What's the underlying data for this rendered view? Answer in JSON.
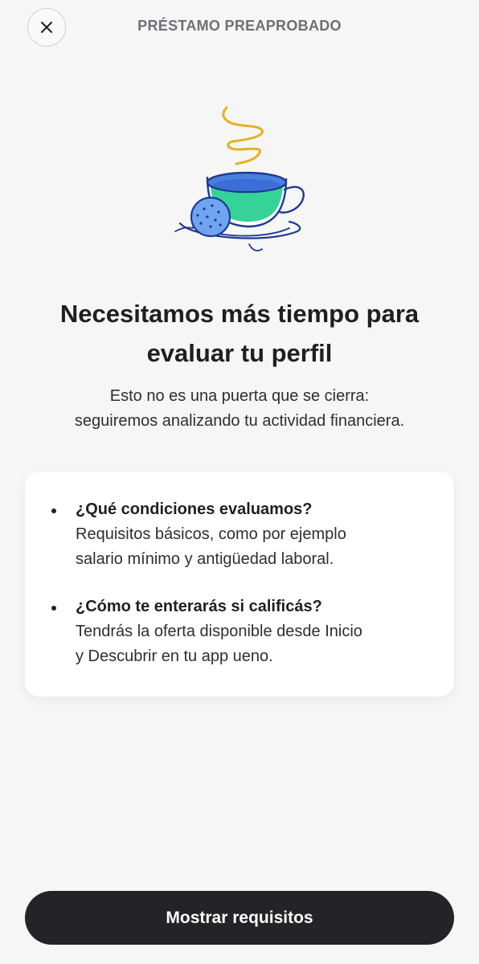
{
  "header": {
    "title": "PRÉSTAMO PREAPROBADO",
    "close_icon": "close-icon"
  },
  "illustration": {
    "name": "tea-cup-with-cookie-illustration",
    "colors": {
      "outline": "#1f3a8f",
      "tea": "#36d399",
      "cup_rim": "#4a7fe0",
      "steam": "#e2b325",
      "cookie": "#6ea4f0"
    }
  },
  "main": {
    "title_line1": "Necesitamos más tiempo para",
    "title_line2": "evaluar tu perfil",
    "subtitle_line1": "Esto no es una puerta que se cierra:",
    "subtitle_line2": "seguiremos analizando tu actividad financiera."
  },
  "info_card": {
    "items": [
      {
        "heading": "¿Qué condiciones evaluamos?",
        "body_line1": "Requisitos básicos, como por ejemplo",
        "body_line2": "salario mínimo y antigüedad laboral."
      },
      {
        "heading": "¿Cómo te enterarás si calificás?",
        "body_line1": "Tendrás la oferta disponible desde Inicio",
        "body_line2": "y Descubrir en tu app ueno."
      }
    ]
  },
  "footer": {
    "button_label": "Mostrar requisitos"
  },
  "colors": {
    "background": "#f6f6f6",
    "primary_button": "#242426",
    "header_text": "#6f6f75"
  }
}
